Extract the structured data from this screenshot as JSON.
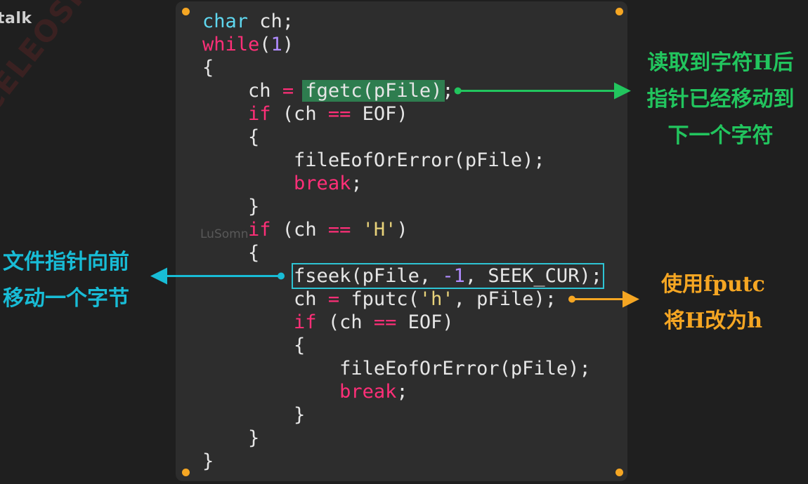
{
  "brand": "talk",
  "watermarks": {
    "rotated": "CELEOSIOI",
    "small": "LuSomn"
  },
  "colors": {
    "background": "#1f1f1f",
    "panel": "#2d2d2d",
    "keyword": "#ff2f78",
    "type": "#5fd7ef",
    "number": "#b18cff",
    "string": "#e8d27a",
    "green_note": "#22c55e",
    "cyan_note": "#18bcd6",
    "orange_note": "#f5a623"
  },
  "code": {
    "l1": {
      "type": "char",
      "rest": " ch;"
    },
    "l2": {
      "kw": "while",
      "open": "(",
      "num": "1",
      "close": ")"
    },
    "l3": {
      "text": "{"
    },
    "l4": {
      "indent": "    ",
      "pre": "ch ",
      "op": "=",
      "sp": " ",
      "call": "fgetc(pFile)",
      "post": ";"
    },
    "l5": {
      "indent": "    ",
      "kw": "if",
      "pre": " (ch ",
      "op": "==",
      "post": " EOF)"
    },
    "l6": {
      "indent": "    ",
      "text": "{"
    },
    "l7": {
      "indent": "        ",
      "text": "fileEofOrError(pFile);"
    },
    "l8": {
      "indent": "        ",
      "kw": "break",
      "post": ";"
    },
    "l9": {
      "indent": "    ",
      "text": "}"
    },
    "l10": {
      "indent": "    ",
      "kw": "if",
      "pre": " (ch ",
      "op": "==",
      "sp": " ",
      "str": "'H'",
      "post": ")"
    },
    "l11": {
      "indent": "    ",
      "text": "{"
    },
    "l12": {
      "indent": "        ",
      "pre": "fseek(pFile, ",
      "num": "-1",
      "post": ", SEEK_CUR);"
    },
    "l13": {
      "indent": "        ",
      "pre": "ch ",
      "op": "=",
      "mid": " fputc(",
      "str": "'h'",
      "post": ", pFile);"
    },
    "l14": {
      "indent": "        ",
      "kw": "if",
      "pre": " (ch ",
      "op": "==",
      "post": " EOF)"
    },
    "l15": {
      "indent": "        ",
      "text": "{"
    },
    "l16": {
      "indent": "            ",
      "text": "fileEofOrError(pFile);"
    },
    "l17": {
      "indent": "            ",
      "kw": "break",
      "post": ";"
    },
    "l18": {
      "indent": "        ",
      "text": "}"
    },
    "l19": {
      "indent": "    ",
      "text": "}"
    },
    "l20": {
      "text": "}"
    }
  },
  "annotations": {
    "green": {
      "line1": "读取到字符H后",
      "line2": "指针已经移动到",
      "line3": "下一个字符"
    },
    "cyan": {
      "line1": "文件指针向前",
      "line2": "移动一个字节"
    },
    "orange": {
      "line1": "使用fputc",
      "line2": "将H改为h"
    }
  }
}
